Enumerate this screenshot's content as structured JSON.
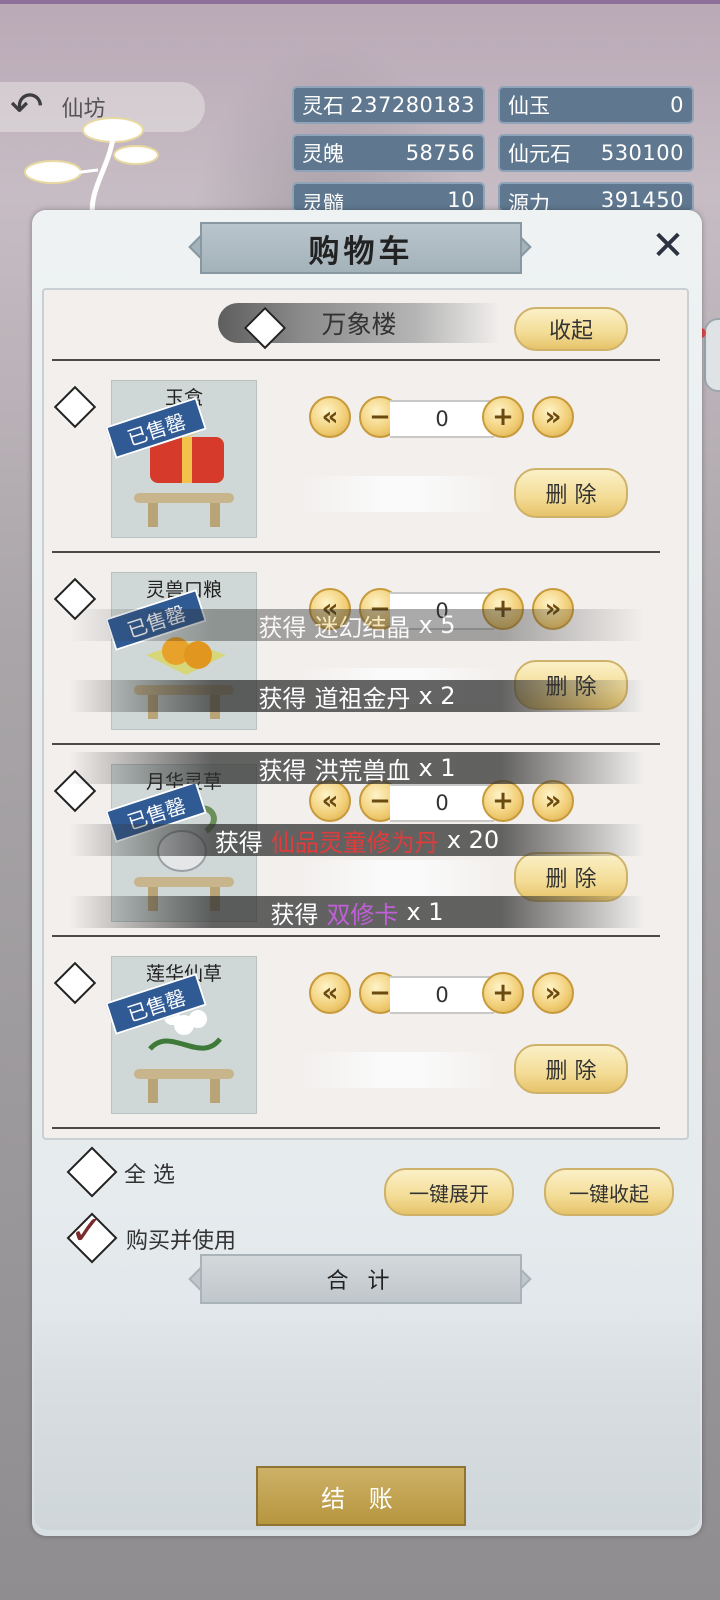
{
  "header": {
    "back_label": "仙坊",
    "currencies": [
      {
        "name": "灵石",
        "value": "237280183"
      },
      {
        "name": "仙玉",
        "value": "0"
      },
      {
        "name": "灵魄",
        "value": "58756"
      },
      {
        "name": "仙元石",
        "value": "530100"
      },
      {
        "name": "灵髓",
        "value": "10"
      },
      {
        "name": "源力",
        "value": "391450"
      }
    ]
  },
  "cart": {
    "title": "购物车",
    "shop_name": "万象楼",
    "collapse_label": "收起",
    "items": [
      {
        "name": "玉盒",
        "badge": "已售罄",
        "quantity": "0",
        "delete_label": "删 除"
      },
      {
        "name": "灵兽口粮",
        "badge": "已售罄",
        "quantity": "0",
        "delete_label": "删 除"
      },
      {
        "name": "月华灵草",
        "badge": "已售罄",
        "quantity": "0",
        "delete_label": "删 除"
      },
      {
        "name": "莲华仙草",
        "badge": "已售罄",
        "quantity": "0",
        "delete_label": "删 除"
      }
    ],
    "select_all_label": "全 选",
    "buy_and_use_label": "购买并使用",
    "expand_all_label": "一键展开",
    "collapse_all_label": "一键收起",
    "total_label": "合 计",
    "checkout_label": "结 账"
  },
  "toasts": [
    {
      "prefix": "获得",
      "item": "迷幻结晶",
      "count": "x 5",
      "item_color": "#ffffff"
    },
    {
      "prefix": "获得",
      "item": "道祖金丹",
      "count": "x 2",
      "item_color": "#ffffff"
    },
    {
      "prefix": "获得",
      "item": "洪荒兽血",
      "count": "x 1",
      "item_color": "#ffffff"
    },
    {
      "prefix": "获得",
      "item": "仙品灵童修为丹",
      "count": "x 20",
      "item_color": "#e03c3c"
    },
    {
      "prefix": "获得",
      "item": "双修卡",
      "count": "x 1",
      "item_color": "#c060d8"
    }
  ],
  "icons": {
    "back": "back-arrow-icon",
    "close": "close-x-icon",
    "min": "double-chevron-left-icon",
    "dec": "minus-icon",
    "inc": "plus-icon",
    "max": "double-chevron-right-icon",
    "checkbox": "diamond-checkbox-icon",
    "check": "checkmark-icon"
  }
}
